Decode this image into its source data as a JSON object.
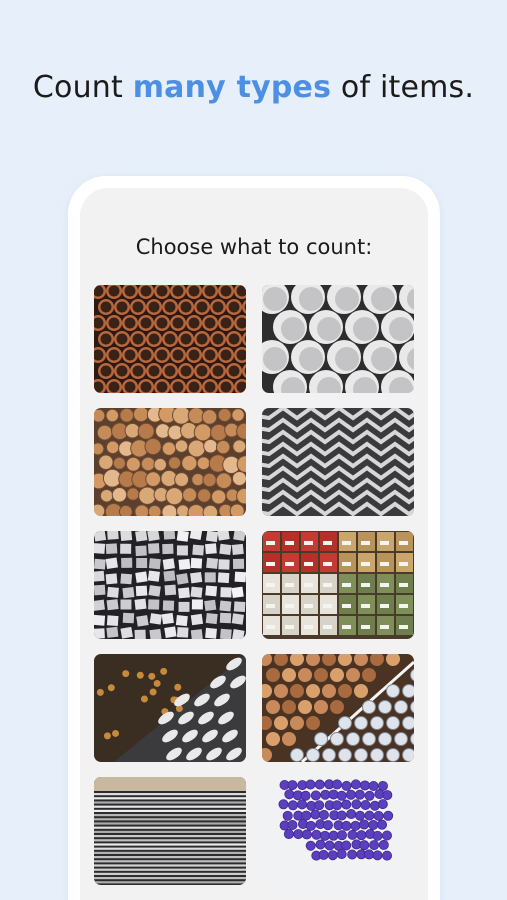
{
  "header": {
    "pre": "Count ",
    "accent": "many types",
    "post": " of items."
  },
  "screen": {
    "prompt": "Choose what to count:"
  },
  "colors": {
    "accent": "#4d8fe2",
    "background": "#e7f0fa"
  },
  "tiles": [
    {
      "id": "copper-pipes"
    },
    {
      "id": "pvc-pipes"
    },
    {
      "id": "wood-logs"
    },
    {
      "id": "steel-angles"
    },
    {
      "id": "foil-blocks"
    },
    {
      "id": "boxes"
    },
    {
      "id": "pills"
    },
    {
      "id": "logs-and-bars"
    },
    {
      "id": "sheet-stack"
    },
    {
      "id": "vials"
    }
  ]
}
